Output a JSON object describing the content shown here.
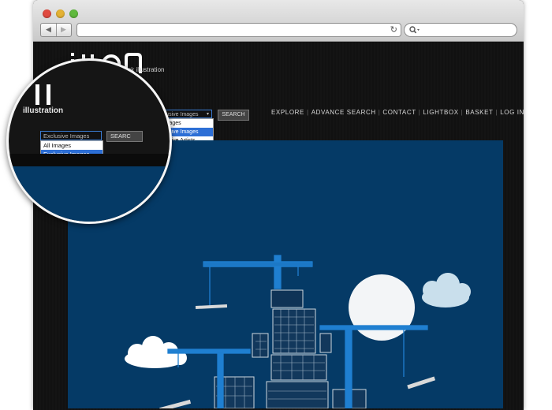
{
  "browser": {
    "back_icon": "back-arrow-icon",
    "forward_icon": "forward-arrow-icon",
    "reload_icon": "reload-icon",
    "search_icon": "search-icon"
  },
  "site": {
    "logo": "IKON",
    "tagline": "first class stock illustration",
    "mag_logo_fragment": "illustration"
  },
  "search": {
    "selected": "Exclusive Images",
    "options": [
      "All Images",
      "Exclusive Images",
      "Exclusive Artists"
    ],
    "selected_index": 1,
    "button_label": "SEARCH",
    "mag_button_label": "SEARC"
  },
  "nav": {
    "items": [
      "EXPLORE",
      "ADVANCE SEARCH",
      "CONTACT",
      "LIGHTBOX",
      "BASKET",
      "LOG IN"
    ]
  },
  "colors": {
    "hero_bg": "#053a66",
    "highlight": "#2d6fd6",
    "crane": "#1f7fd1"
  }
}
